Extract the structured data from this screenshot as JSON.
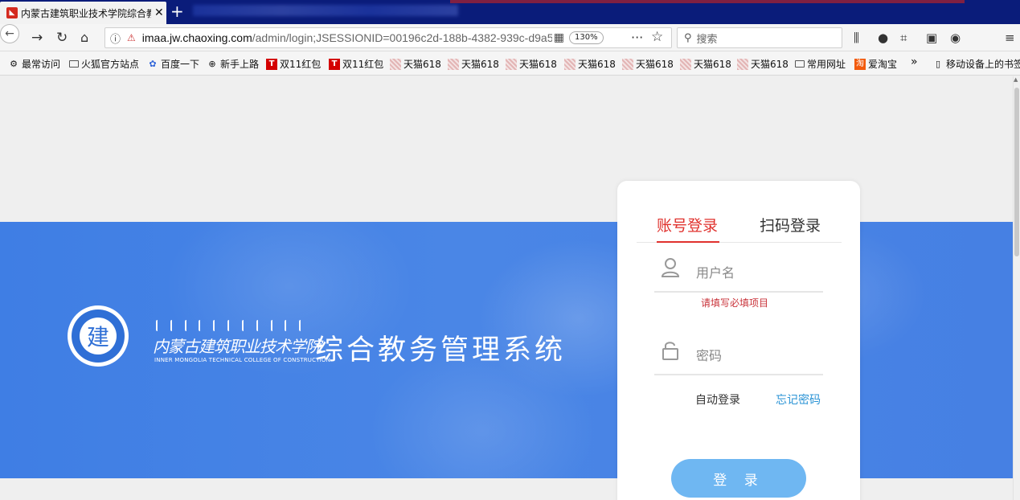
{
  "browser": {
    "tab_title": "内蒙古建筑职业技术学院综合教务管理系统",
    "url_host": "imaa.jw.chaoxing.com",
    "url_path": "/admin/login;JSESSIONID=00196c2d-188b-4382-939c-d9a5",
    "zoom": "130%",
    "search_placeholder": "搜索",
    "bookmarks": [
      {
        "label": "最常访问",
        "icon": "gear-icon"
      },
      {
        "label": "火狐官方站点",
        "icon": "folder-icon"
      },
      {
        "label": "百度一下",
        "icon": "baidu-paw-icon"
      },
      {
        "label": "新手上路",
        "icon": "globe-icon"
      },
      {
        "label": "双11红包",
        "icon": "tmall-t-icon"
      },
      {
        "label": "双11红包",
        "icon": "tmall-t-icon"
      },
      {
        "label": "天猫618",
        "icon": "tmall-icon"
      },
      {
        "label": "天猫618",
        "icon": "tmall-icon"
      },
      {
        "label": "天猫618",
        "icon": "tmall-icon"
      },
      {
        "label": "天猫618",
        "icon": "tmall-icon"
      },
      {
        "label": "天猫618",
        "icon": "tmall-icon"
      },
      {
        "label": "天猫618",
        "icon": "tmall-icon"
      },
      {
        "label": "常用网址",
        "icon": "folder-icon"
      },
      {
        "label": "爱淘宝",
        "icon": "taobao-icon"
      }
    ],
    "bookmarks_more": "»",
    "mobile_bookmarks": "移动设备上的书签"
  },
  "page": {
    "school_name": "内蒙古建筑职业技术学院",
    "school_name_en": "INNER MONGOLIA TECHNICAL COLLEGE OF CONSTRUCTION",
    "system_title": "综合教务管理系统"
  },
  "login": {
    "tab_account": "账号登录",
    "tab_qr": "扫码登录",
    "username_placeholder": "用户名",
    "required_msg": "请填写必填项目",
    "password_placeholder": "密码",
    "auto_login": "自动登录",
    "forgot_password": "忘记密码",
    "submit": "登 录"
  },
  "colors": {
    "banner_blue": "#4a86e6",
    "accent_red": "#e0322e",
    "link_blue": "#2a93d5",
    "button_blue": "#6fb7f2"
  }
}
